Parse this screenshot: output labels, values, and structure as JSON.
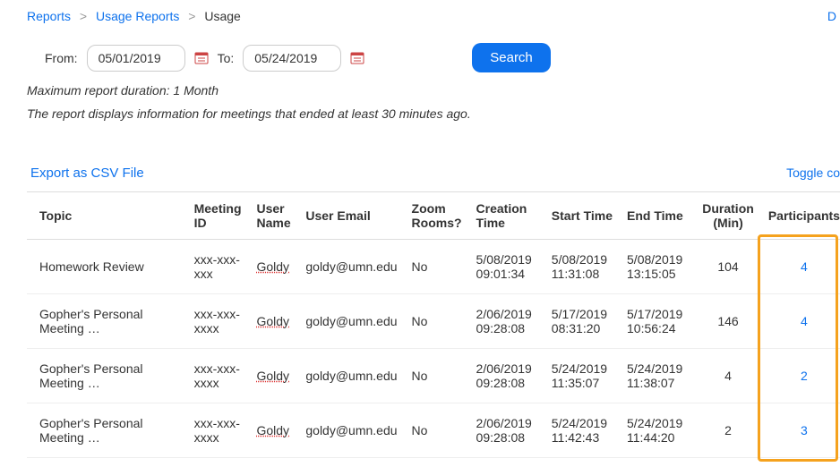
{
  "breadcrumb": {
    "reports": "Reports",
    "usage_reports": "Usage Reports",
    "usage": "Usage"
  },
  "top_right": "D",
  "filters": {
    "from_label": "From:",
    "from_value": "05/01/2019",
    "to_label": "To:",
    "to_value": "05/24/2019",
    "search_label": "Search"
  },
  "notes": {
    "max_duration": "Maximum report duration: 1 Month",
    "delay_note": "The report displays information for meetings that ended at least 30 minutes ago."
  },
  "links": {
    "export_csv": "Export as CSV File",
    "toggle": "Toggle co"
  },
  "table": {
    "headers": {
      "topic": "Topic",
      "meeting_id": "Meeting ID",
      "user_name": "User Name",
      "user_email": "User Email",
      "zoom_rooms": "Zoom Rooms?",
      "creation_time": "Creation Time",
      "start_time": "Start Time",
      "end_time": "End Time",
      "duration": "Duration (Min)",
      "participants": "Participants"
    },
    "rows": [
      {
        "topic": "Homework Review",
        "meeting_id": "xxx-xxx-xxx",
        "user_name": "Goldy",
        "user_email": "goldy@umn.edu",
        "zoom_rooms": "No",
        "creation_time": "5/08/2019 09:01:34",
        "start_time": "5/08/2019 11:31:08",
        "end_time": "5/08/2019 13:15:05",
        "duration": "104",
        "participants": "4"
      },
      {
        "topic": "Gopher's Personal Meeting …",
        "meeting_id": "xxx-xxx-xxxx",
        "user_name": "Goldy",
        "user_email": "goldy@umn.edu",
        "zoom_rooms": "No",
        "creation_time": "2/06/2019 09:28:08",
        "start_time": "5/17/2019 08:31:20",
        "end_time": "5/17/2019 10:56:24",
        "duration": "146",
        "participants": "4"
      },
      {
        "topic": "Gopher's Personal Meeting …",
        "meeting_id": "xxx-xxx-xxxx",
        "user_name": "Goldy",
        "user_email": "goldy@umn.edu",
        "zoom_rooms": "No",
        "creation_time": "2/06/2019 09:28:08",
        "start_time": "5/24/2019 11:35:07",
        "end_time": "5/24/2019 11:38:07",
        "duration": "4",
        "participants": "2"
      },
      {
        "topic": "Gopher's Personal Meeting …",
        "meeting_id": "xxx-xxx-xxxx",
        "user_name": "Goldy",
        "user_email": "goldy@umn.edu",
        "zoom_rooms": "No",
        "creation_time": "2/06/2019 09:28:08",
        "start_time": "5/24/2019 11:42:43",
        "end_time": "5/24/2019 11:44:20",
        "duration": "2",
        "participants": "3"
      }
    ]
  }
}
